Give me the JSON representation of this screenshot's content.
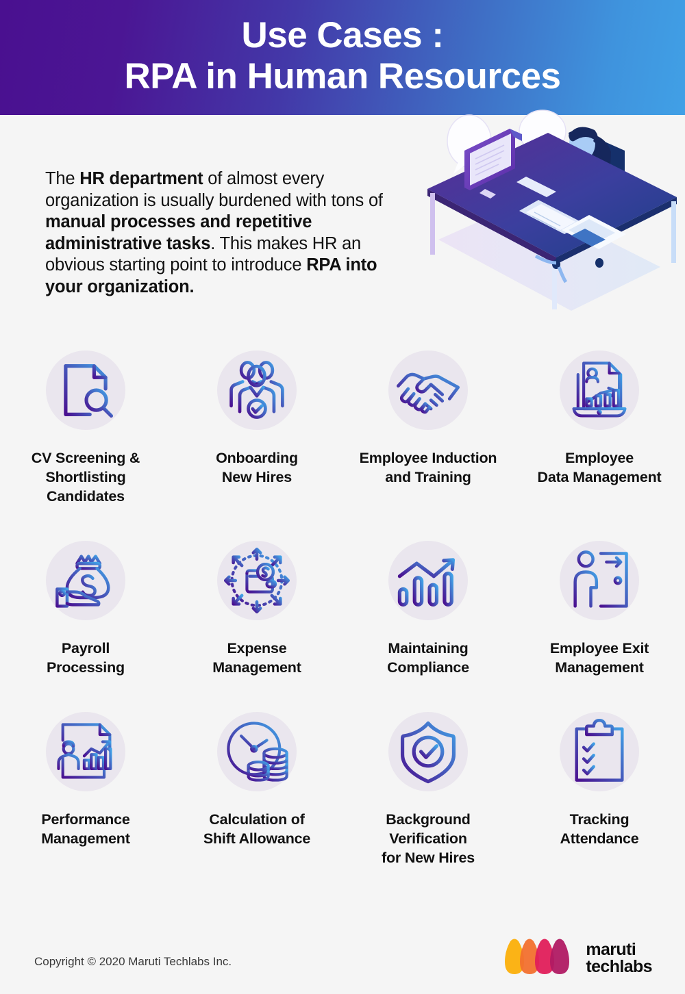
{
  "header": {
    "title_line1": "Use Cases :",
    "title_line2": "RPA in Human Resources",
    "gradient_start": "#4a1090",
    "gradient_end": "#41a0e6"
  },
  "intro": {
    "part1": "The ",
    "bold1": "HR department",
    "part2": " of almost every organization is usually burdened with tons of ",
    "bold2": "manual processes and repetitive administrative tasks",
    "part3": ". This makes HR an obvious starting point to introduce ",
    "bold3": "RPA into your organization."
  },
  "illustration": {
    "name": "hr-professional-at-desk-illustration",
    "alt": "Isometric illustration of a woman seated at a desk with monitor, keyboard and documents with speech bubbles"
  },
  "use_cases": [
    {
      "label_line1": "CV Screening &",
      "label_line2": "Shortlisting",
      "label_line3": "Candidates",
      "icon": "document-search-icon"
    },
    {
      "label_line1": "Onboarding",
      "label_line2": "New Hires",
      "label_line3": "",
      "icon": "team-verified-icon"
    },
    {
      "label_line1": "Employee Induction",
      "label_line2": "and Training",
      "label_line3": "",
      "icon": "handshake-icon"
    },
    {
      "label_line1": "Employee",
      "label_line2": "Data Management",
      "label_line3": "",
      "icon": "laptop-profile-chart-icon"
    },
    {
      "label_line1": "Payroll",
      "label_line2": "Processing",
      "label_line3": "",
      "icon": "hand-money-bag-icon"
    },
    {
      "label_line1": "Expense",
      "label_line2": "Management",
      "label_line3": "",
      "icon": "wallet-arrows-icon"
    },
    {
      "label_line1": "Maintaining",
      "label_line2": "Compliance",
      "label_line3": "",
      "icon": "growth-bar-chart-icon"
    },
    {
      "label_line1": "Employee Exit",
      "label_line2": "Management",
      "label_line3": "",
      "icon": "person-exit-door-icon"
    },
    {
      "label_line1": "Performance",
      "label_line2": "Management",
      "label_line3": "",
      "icon": "report-person-chart-icon"
    },
    {
      "label_line1": "Calculation of",
      "label_line2": "Shift Allowance",
      "label_line3": "",
      "icon": "clock-coins-icon"
    },
    {
      "label_line1": "Background",
      "label_line2": "Verification",
      "label_line3": "for New Hires",
      "icon": "shield-check-icon"
    },
    {
      "label_line1": "Tracking",
      "label_line2": "Attendance",
      "label_line3": "",
      "icon": "clipboard-checklist-icon"
    }
  ],
  "footer": {
    "copyright": "Copyright © 2020 Maruti Techlabs Inc.",
    "logo_line1": "maruti",
    "logo_line2": "techlabs",
    "logo_colors": {
      "amber": "#fbb316",
      "orange": "#f2702e",
      "pink": "#e01e5a",
      "magenta": "#b01a63"
    }
  },
  "theme": {
    "page_background": "#f5f5f5",
    "icon_circle": "#eae6ee",
    "icon_gradient_start": "#4a1090",
    "icon_gradient_end": "#41a0e6",
    "text_color": "#111111"
  }
}
